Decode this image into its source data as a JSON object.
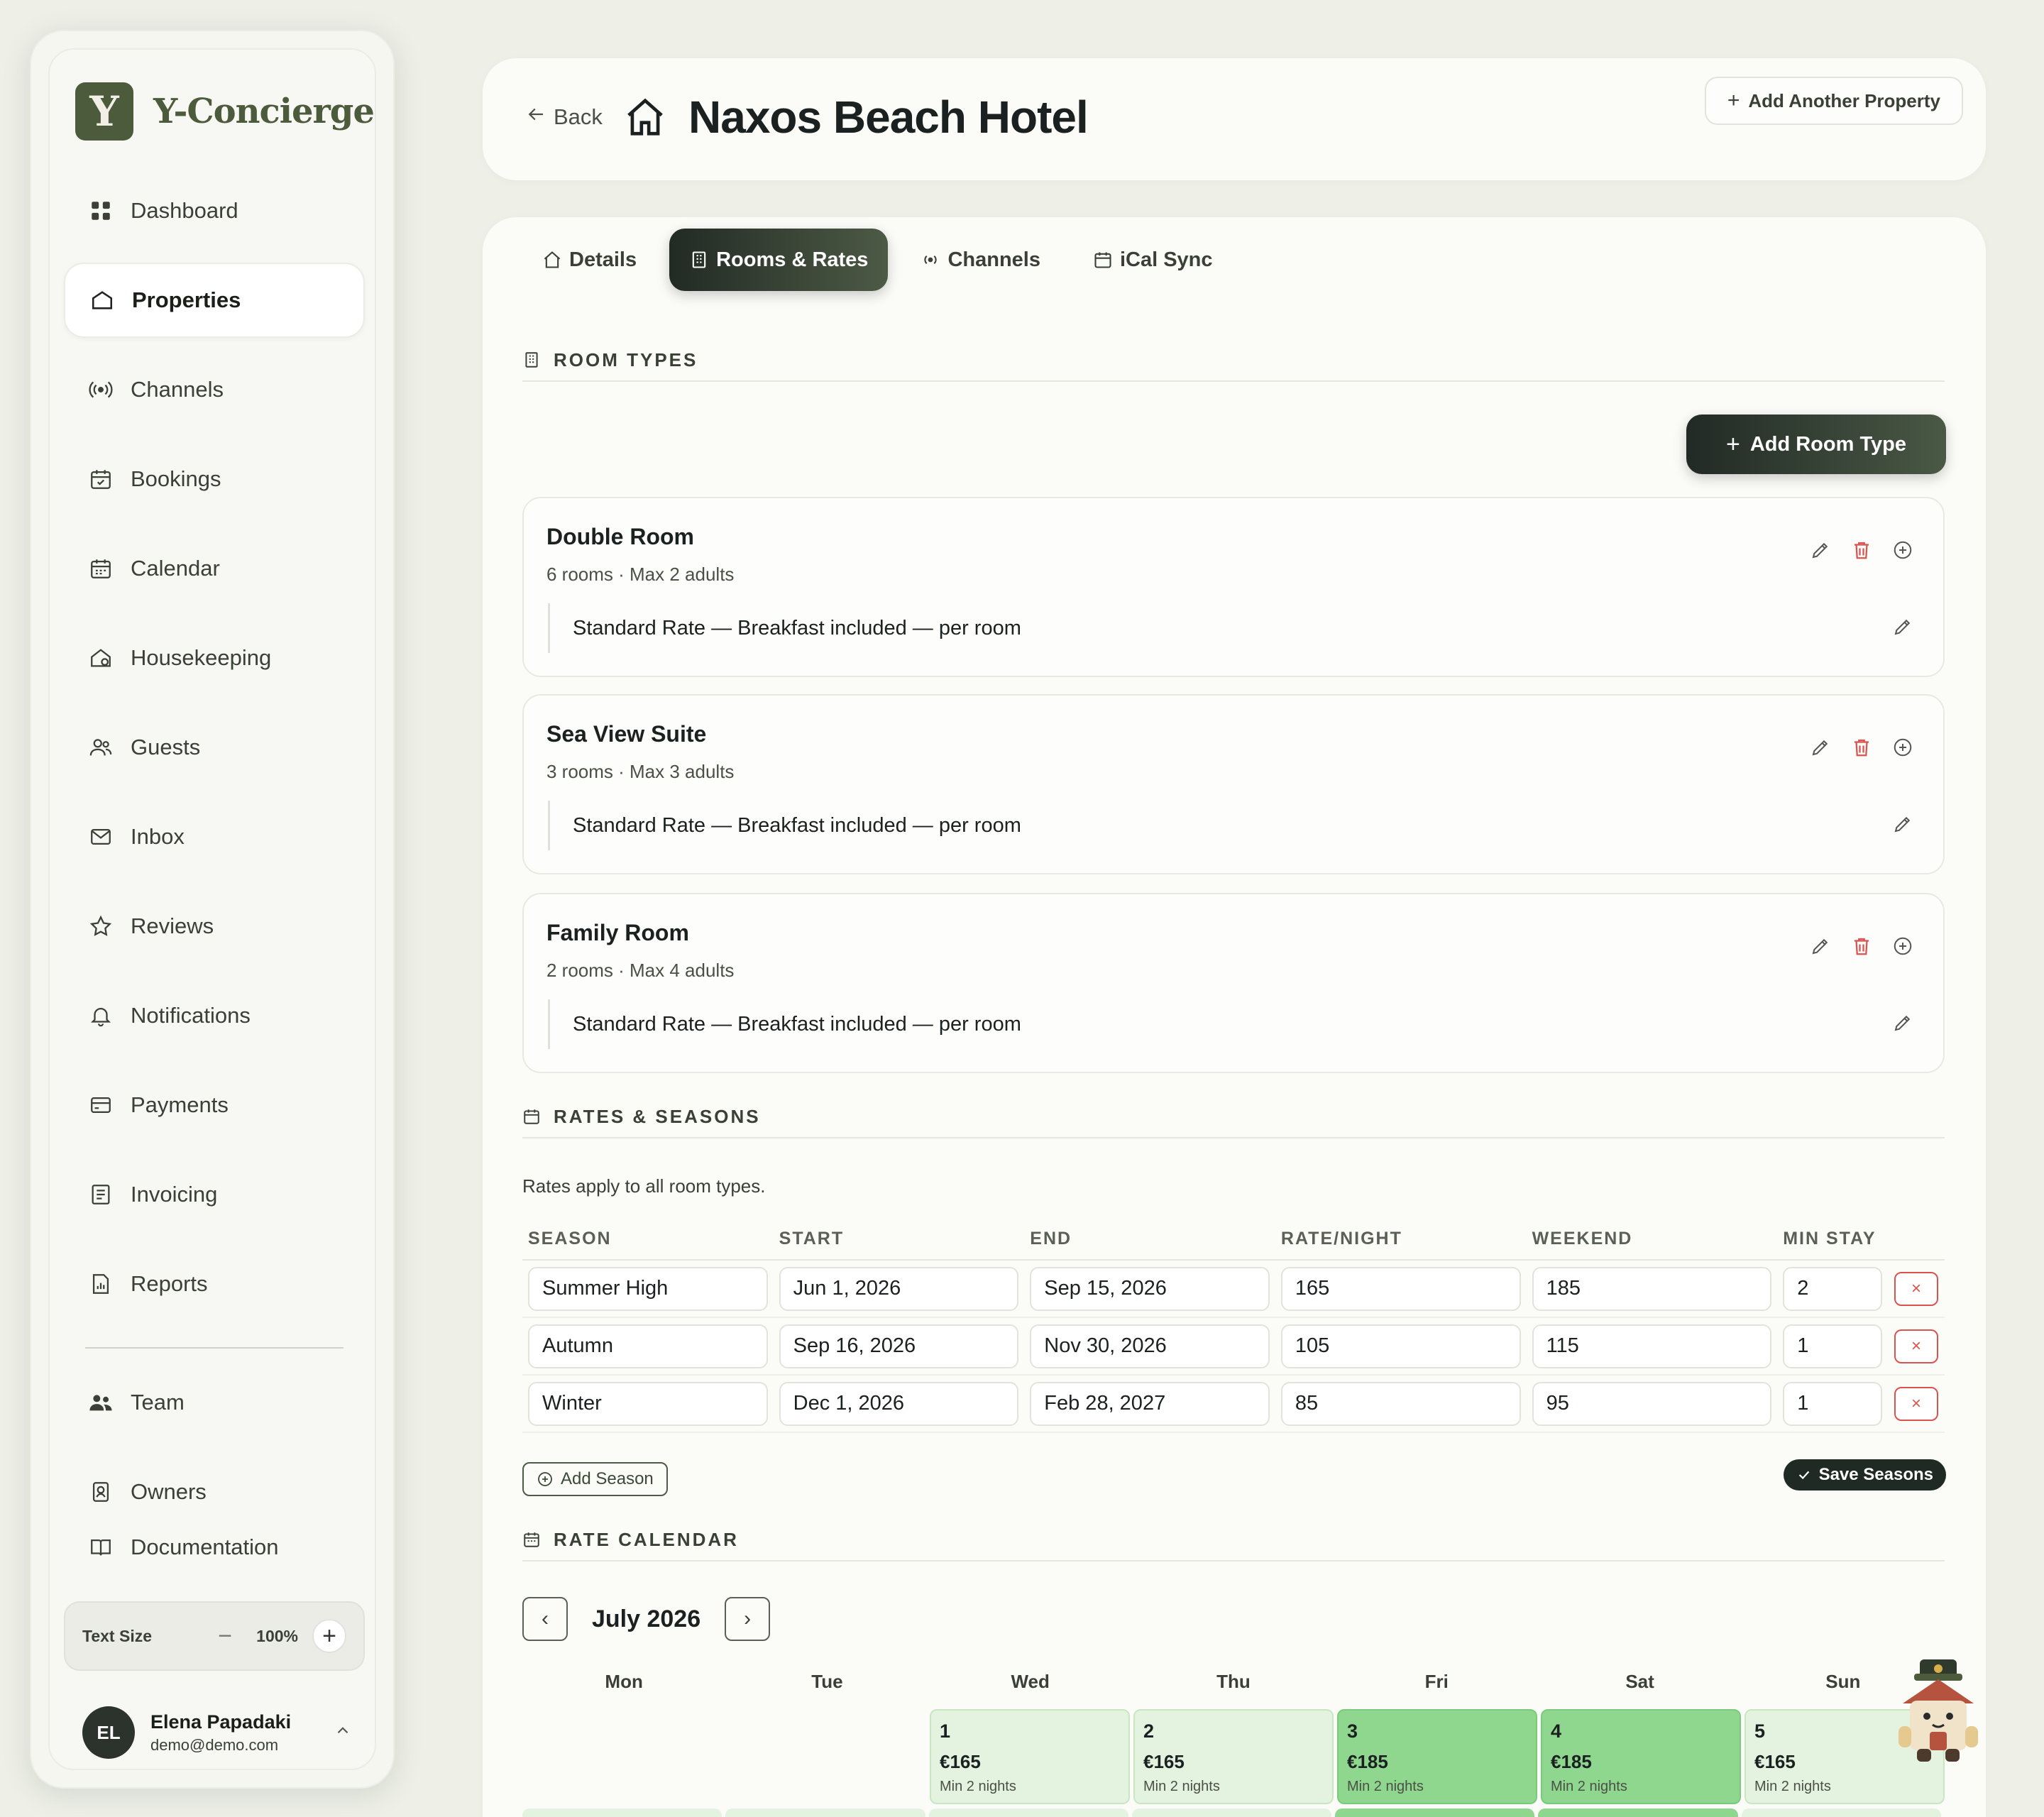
{
  "brand": {
    "logo_letter": "Y",
    "name": "Y-Concierge"
  },
  "sidebar": {
    "items": [
      {
        "label": "Dashboard",
        "icon": "grid-icon"
      },
      {
        "label": "Properties",
        "icon": "building-icon",
        "active": true
      },
      {
        "label": "Channels",
        "icon": "broadcast-icon"
      },
      {
        "label": "Bookings",
        "icon": "calendar-check-icon"
      },
      {
        "label": "Calendar",
        "icon": "calendar-icon"
      },
      {
        "label": "Housekeeping",
        "icon": "house-clean-icon"
      },
      {
        "label": "Guests",
        "icon": "users-icon"
      },
      {
        "label": "Inbox",
        "icon": "mail-icon"
      },
      {
        "label": "Reviews",
        "icon": "star-icon"
      },
      {
        "label": "Notifications",
        "icon": "bell-icon"
      },
      {
        "label": "Payments",
        "icon": "credit-card-icon"
      },
      {
        "label": "Invoicing",
        "icon": "invoice-icon"
      },
      {
        "label": "Reports",
        "icon": "report-icon"
      },
      {
        "label": "Team",
        "icon": "team-icon"
      },
      {
        "label": "Owners",
        "icon": "owner-icon"
      },
      {
        "label": "Documentation",
        "icon": "book-icon"
      }
    ],
    "text_size": {
      "label": "Text Size",
      "minus": "−",
      "value": "100%",
      "plus": "+"
    },
    "user": {
      "initials": "EL",
      "name": "Elena Papadaki",
      "email": "demo@demo.com"
    }
  },
  "header": {
    "back_label": "Back",
    "title": "Naxos Beach Hotel",
    "add_property_label": "Add Another Property"
  },
  "tabs": [
    {
      "label": "Details",
      "icon": "home-icon"
    },
    {
      "label": "Rooms & Rates",
      "icon": "building-icon",
      "active": true
    },
    {
      "label": "Channels",
      "icon": "broadcast-icon"
    },
    {
      "label": "iCal Sync",
      "icon": "calendar-icon"
    }
  ],
  "room_types": {
    "heading": "ROOM TYPES",
    "add_label": "Add Room Type",
    "rooms": [
      {
        "name": "Double Room",
        "meta": "6 rooms · Max 2 adults",
        "rate": "Standard Rate — Breakfast included — per room"
      },
      {
        "name": "Sea View Suite",
        "meta": "3 rooms · Max 3 adults",
        "rate": "Standard Rate — Breakfast included — per room"
      },
      {
        "name": "Family Room",
        "meta": "2 rooms · Max 4 adults",
        "rate": "Standard Rate — Breakfast included — per room"
      }
    ]
  },
  "rates": {
    "heading": "RATES & SEASONS",
    "note": "Rates apply to all room types.",
    "columns": [
      "SEASON",
      "START",
      "END",
      "RATE/NIGHT",
      "WEEKEND",
      "MIN STAY"
    ],
    "rows": [
      {
        "season": "Summer High",
        "start": "Jun 1, 2026",
        "end": "Sep 15, 2026",
        "rate": "165",
        "weekend": "185",
        "min": "2"
      },
      {
        "season": "Autumn",
        "start": "Sep 16, 2026",
        "end": "Nov 30, 2026",
        "rate": "105",
        "weekend": "115",
        "min": "1"
      },
      {
        "season": "Winter",
        "start": "Dec 1, 2026",
        "end": "Feb 28, 2027",
        "rate": "85",
        "weekend": "95",
        "min": "1"
      }
    ],
    "delete_glyph": "×",
    "add_season_label": "Add Season",
    "save_label": "Save Seasons"
  },
  "calendar": {
    "heading": "RATE CALENDAR",
    "month": "July 2026",
    "prev_glyph": "‹",
    "next_glyph": "›",
    "weekdays": [
      "Mon",
      "Tue",
      "Wed",
      "Thu",
      "Fri",
      "Sat",
      "Sun"
    ],
    "cells": [
      {
        "day": "",
        "price": "",
        "min": ""
      },
      {
        "day": "",
        "price": "",
        "min": ""
      },
      {
        "day": "1",
        "price": "€165",
        "min": "Min 2 nights"
      },
      {
        "day": "2",
        "price": "€165",
        "min": "Min 2 nights"
      },
      {
        "day": "3",
        "price": "€185",
        "min": "Min 2 nights"
      },
      {
        "day": "4",
        "price": "€185",
        "min": "Min 2 nights"
      },
      {
        "day": "5",
        "price": "€165",
        "min": "Min 2 nights"
      }
    ]
  },
  "colors": {
    "brand": "#4c5b3c",
    "weekday_cell": "#e4f3e0",
    "weekend_cell": "#8fd68f",
    "danger": "#d9534f"
  }
}
